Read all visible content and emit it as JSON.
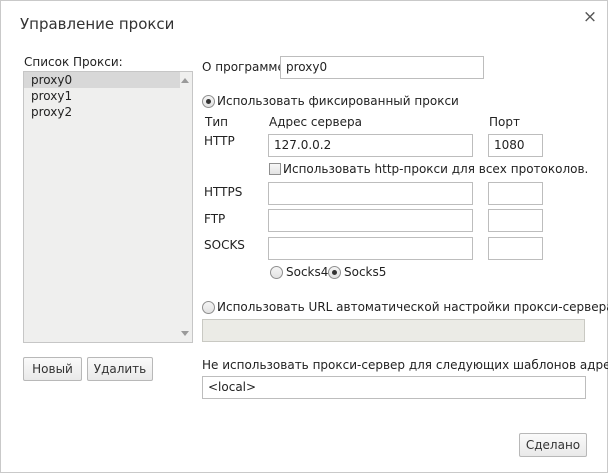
{
  "dialog": {
    "title": "Управление прокси",
    "close_symbol": "×"
  },
  "proxy_list": {
    "label": "Список Прокси:",
    "items": [
      "proxy0",
      "proxy1",
      "proxy2"
    ],
    "selected_index": 0
  },
  "buttons": {
    "new_label": "Новый",
    "delete_label": "Удалить",
    "done_label": "Сделано"
  },
  "program": {
    "label": "О программе:",
    "value": "proxy0"
  },
  "fixed_proxy": {
    "radio_label": "Использовать фиксированный прокси",
    "checked": true,
    "col_type": "Тип",
    "col_address": "Адрес сервера",
    "col_port": "Порт",
    "http": {
      "label": "HTTP",
      "address": "127.0.0.2",
      "port": "1080"
    },
    "use_for_all_label": "Использовать http-прокси для всех протоколов.",
    "use_for_all_checked": false,
    "https": {
      "label": "HTTPS",
      "address": "",
      "port": ""
    },
    "ftp": {
      "label": "FTP",
      "address": "",
      "port": ""
    },
    "socks": {
      "label": "SOCKS",
      "address": "",
      "port": ""
    },
    "socks4_label": "Socks4",
    "socks5_label": "Socks5",
    "socks_version_selected": "Socks5"
  },
  "auto_config": {
    "radio_label": "Использовать URL автоматической настройки прокси-сервера:",
    "checked": false,
    "url": ""
  },
  "bypass": {
    "label": "Не использовать прокси-сервер для следующих шаблонов адресов:",
    "value": "<local>"
  }
}
